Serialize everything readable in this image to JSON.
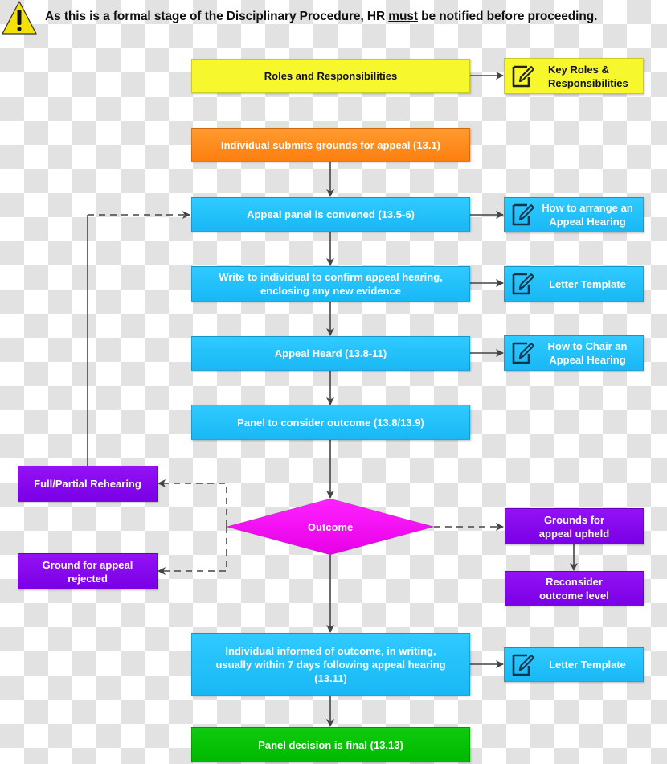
{
  "warning": {
    "icon": "warning-triangle-icon",
    "text_before": "As this is a formal stage of the Disciplinary Procedure, HR ",
    "text_emphasis": "must",
    "text_after": " be notified before proceeding."
  },
  "colors": {
    "yellow": "#f7f72e",
    "orange": "#fd8a1e",
    "blue": "#22c1fa",
    "purple": "#8a08f0",
    "magenta": "#f20ff2",
    "green": "#06c206",
    "connector": "#444444"
  },
  "flow": {
    "roles": "Roles and Responsibilities",
    "submit": "Individual submits grounds for appeal (13.1)",
    "convened": "Appeal panel is convened (13.5-6)",
    "write": "Write to individual to confirm appeal hearing, enclosing any new evidence",
    "heard": "Appeal Heard (13.8-11)",
    "consider": "Panel to consider outcome (13.8/13.9)",
    "outcome": "Outcome",
    "informed": "Individual informed of outcome, in writing, usually within 7 days following appeal hearing (13.11)",
    "final": "Panel decision is final (13.13)"
  },
  "branches": {
    "rehearing": "Full/Partial Rehearing",
    "rejected": "Ground for appeal rejected",
    "upheld": "Grounds for appeal upheld",
    "reconsider": "Reconsider outcome level"
  },
  "resources": [
    {
      "label": "Key Roles & Responsibilities",
      "icon": "edit-document-icon"
    },
    {
      "label": "How to arrange an Appeal Hearing",
      "icon": "edit-document-icon"
    },
    {
      "label": "Letter Template",
      "icon": "edit-document-icon"
    },
    {
      "label": "How to Chair an Appeal Hearing",
      "icon": "edit-document-icon"
    },
    {
      "label": "Letter Template",
      "icon": "edit-document-icon"
    }
  ]
}
